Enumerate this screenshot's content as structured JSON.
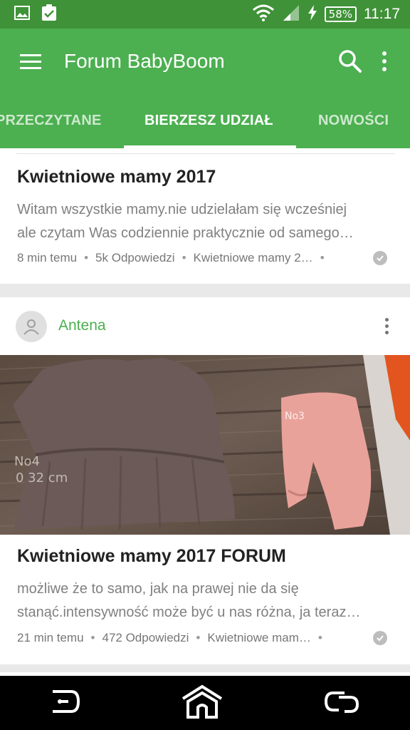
{
  "status_bar": {
    "battery": "58%",
    "time": "11:17",
    "icons": [
      "image-icon",
      "clipboard-check-icon",
      "wifi-icon",
      "signal-icon",
      "charging-icon"
    ]
  },
  "app_bar": {
    "title": "Forum BabyBoom",
    "icons": [
      "menu-icon",
      "search-icon",
      "more-vert-icon"
    ]
  },
  "tabs": [
    {
      "label": "PRZECZYTANE",
      "selected": false
    },
    {
      "label": "BIERZESZ UDZIAŁ",
      "selected": true
    },
    {
      "label": "NOWOŚCI",
      "selected": false
    }
  ],
  "posts": [
    {
      "title": "Kwietniowe mamy 2017",
      "body_lines": [
        "Witam wszystkie mamy.nie udzielałam się wcześniej",
        "ale czytam Was codziennie praktycznie od samego…"
      ],
      "time": "8 min temu",
      "replies": "5k Odpowiedzi",
      "forum": "Kwietniowe mamy 2…"
    },
    {
      "author": "Antena",
      "title": "Kwietniowe mamy 2017 FORUM",
      "body_lines": [
        "możliwe że to samo, jak na prawej nie da się",
        "stanąć.intensywność może być u nas różna, ja teraz…"
      ],
      "time": "21 min temu",
      "replies": "472 Odpowiedzi",
      "forum": "Kwietniowe mam…"
    }
  ],
  "colors": {
    "status_bar": "#3f9238",
    "app_bar": "#4caf50",
    "author": "#4caf50"
  },
  "nav_bar": {
    "icons": [
      "back-icon",
      "home-icon",
      "recents-icon"
    ]
  }
}
